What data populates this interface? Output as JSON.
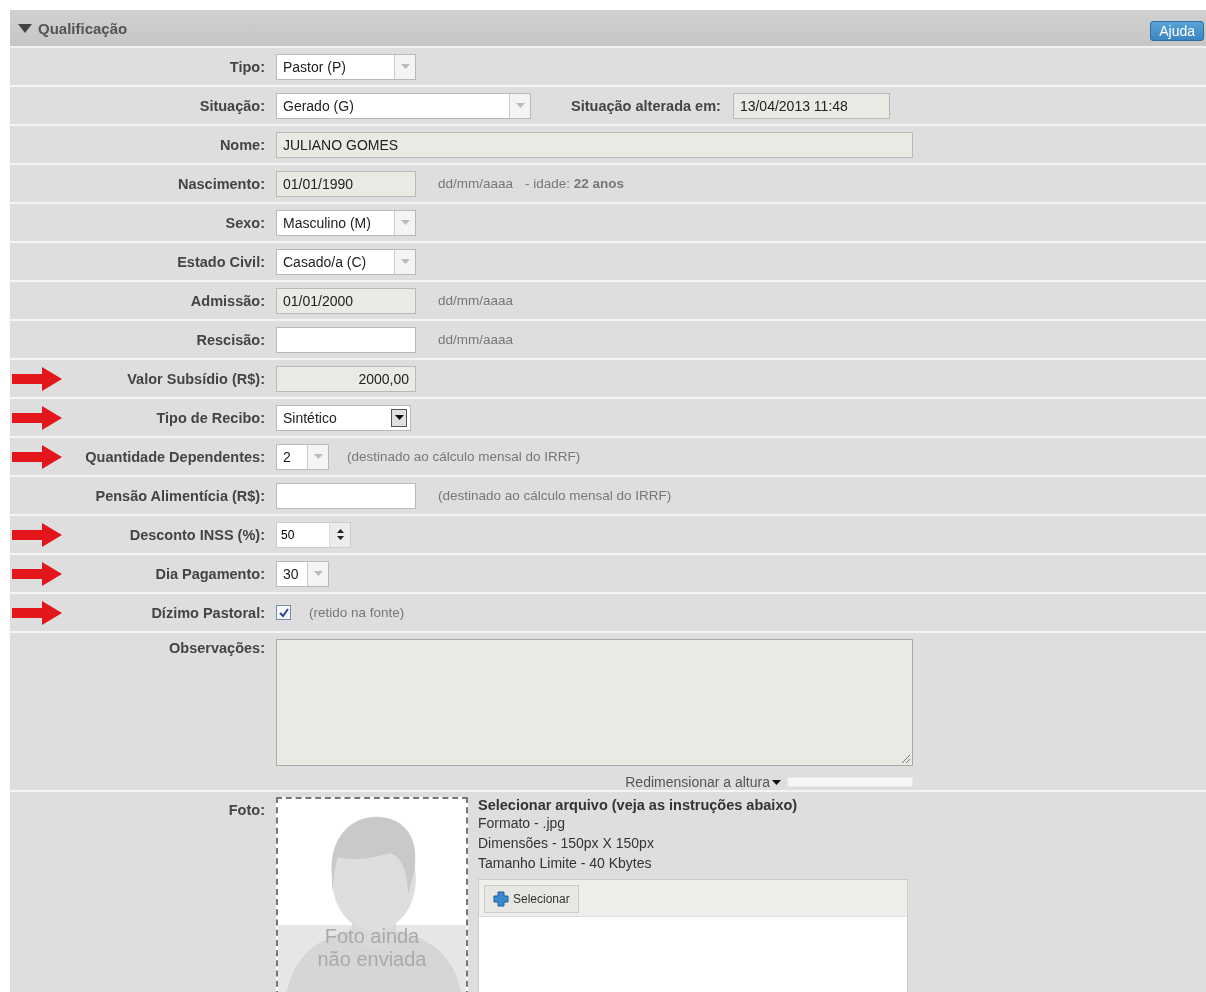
{
  "section": {
    "title": "Qualificação",
    "expanded": true
  },
  "help_button": "Ajuda",
  "rows": [
    {
      "label": "Tipo:",
      "kind": "select",
      "value": "Pastor (P)",
      "disabled": true,
      "flagged": false
    },
    {
      "label": "Situação:",
      "kind": "select",
      "value": "Gerado (G)",
      "disabled": true,
      "flagged": false,
      "side_label": "Situação alterada em:",
      "side_value": "13/04/2013 11:48"
    },
    {
      "label": "Nome:",
      "kind": "text",
      "value": "JULIANO GOMES",
      "readonly": true,
      "flagged": false
    },
    {
      "label": "Nascimento:",
      "kind": "text",
      "value": "01/01/1990",
      "readonly": true,
      "flagged": false,
      "hint": "dd/mm/aaaa",
      "note": "- idade: **22 anos**"
    },
    {
      "label": "Sexo:",
      "kind": "select",
      "value": "Masculino (M)",
      "disabled": true,
      "flagged": false
    },
    {
      "label": "Estado Civil:",
      "kind": "select",
      "value": "Casado/a (C)",
      "disabled": true,
      "flagged": false
    },
    {
      "label": "Admissão:",
      "kind": "text",
      "value": "01/01/2000",
      "readonly": true,
      "flagged": false,
      "hint": "dd/mm/aaaa"
    },
    {
      "label": "Rescisão:",
      "kind": "text",
      "readonly": false,
      "flagged": false,
      "hint": "dd/mm/aaaa"
    },
    {
      "label": "Valor Subsídio (R$):",
      "kind": "text",
      "value": "2000,00",
      "readonly": true,
      "flagged": true
    },
    {
      "label": "Tipo de Recibo:",
      "kind": "select",
      "value": "Sintético",
      "disabled": false,
      "flagged": true
    },
    {
      "label": "Quantidade Dependentes:",
      "kind": "select",
      "value": "2",
      "disabled": true,
      "flagged": true,
      "hint": "(destinado ao cálculo mensal do IRRF)"
    },
    {
      "label": "Pensão Alimentícia (R$):",
      "kind": "text",
      "readonly": false,
      "flagged": false,
      "hint": "(destinado ao cálculo mensal do IRRF)"
    },
    {
      "label": "Desconto INSS (%):",
      "kind": "spinner",
      "value": "50",
      "flagged": true
    },
    {
      "label": "Dia Pagamento:",
      "kind": "select",
      "value": "30",
      "disabled": true,
      "flagged": true
    },
    {
      "label": "Dízimo Pastoral:",
      "kind": "checkbox",
      "checked": true,
      "flagged": true,
      "hint": "(retido na fonte)"
    },
    {
      "label": "Observações:",
      "kind": "textarea",
      "readonly": true,
      "flagged": false,
      "resize_label": "Redimensionar a altura"
    },
    {
      "label": "Foto:",
      "kind": "photo",
      "flagged": false,
      "photo_placeholder": "Foto ainda não enviada",
      "instructions_title": "Selecionar arquivo (veja as instruções abaixo)",
      "instructions": [
        "Formato - .jpg",
        "Dimensões - 150px X 150px",
        "Tamanho Limite - 40 Kbytes"
      ],
      "upload_button": "Selecionar"
    }
  ]
}
